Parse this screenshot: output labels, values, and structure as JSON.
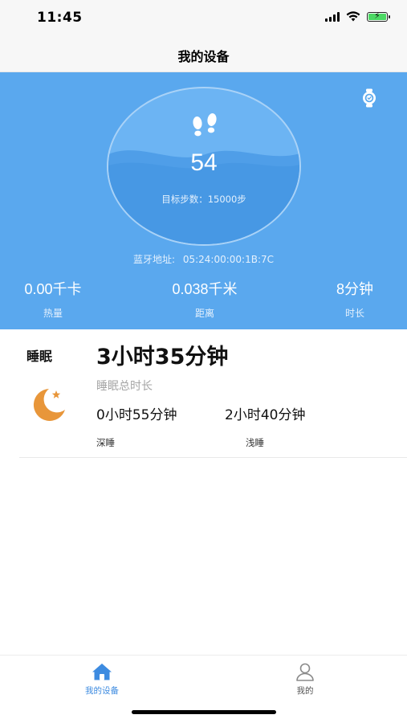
{
  "status_bar": {
    "time": "11:45",
    "icons": [
      "signal-icon",
      "wifi-icon",
      "battery-charging-icon"
    ]
  },
  "nav": {
    "title": "我的设备"
  },
  "hero": {
    "background_color": "#5aa8ee",
    "watch_icon": "watch-icon",
    "feet_icon": "footprints-icon",
    "steps": "54",
    "goal_text": "目标步数：15000步",
    "bluetooth_label": "蓝牙地址:",
    "bluetooth_address": "05:24:00:00:1B:7C",
    "stats": {
      "calories": {
        "value": "0.00千卡",
        "label": "热量"
      },
      "distance": {
        "value": "0.038千米",
        "label": "距离"
      },
      "duration": {
        "value": "8分钟",
        "label": "时长"
      }
    }
  },
  "sleep": {
    "label": "睡眠",
    "icon": "moon-icon",
    "total": "3小时35分钟",
    "total_label": "睡眠总时长",
    "deep": {
      "value": "0小时55分钟",
      "label": "深睡"
    },
    "light": {
      "value": "2小时40分钟",
      "label": "浅睡"
    }
  },
  "tabs": [
    {
      "label": "我的设备",
      "icon": "home-icon",
      "active": true
    },
    {
      "label": "我的",
      "icon": "person-icon",
      "active": false
    }
  ],
  "colors": {
    "accent": "#3d8be0",
    "moon": "#e8963a"
  }
}
